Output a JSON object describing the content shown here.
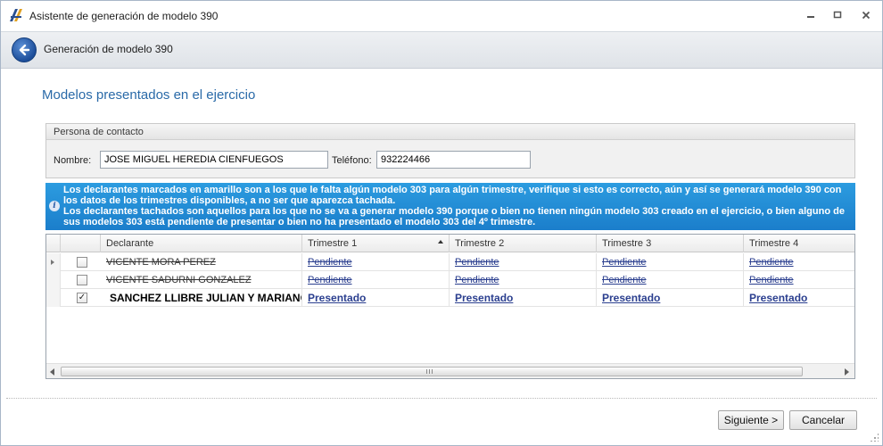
{
  "window": {
    "title": "Asistente de generación de modelo 390"
  },
  "header": {
    "title": "Generación de modelo 390"
  },
  "page": {
    "title": "Modelos presentados en el ejercicio"
  },
  "contact": {
    "group_title": "Persona de contacto",
    "name_label": "Nombre:",
    "name_value": "JOSE MIGUEL HEREDIA CIENFUEGOS",
    "phone_label": "Teléfono:",
    "phone_value": "932224466"
  },
  "banner": {
    "line1": "Los declarantes marcados en amarillo son a los que le falta algún modelo 303 para algún trimestre, verifique si esto es correcto, aún y así se generará modelo 390 con los datos de los trimestres disponibles, a no ser que aparezca tachada.",
    "line2": "Los declarantes tachados son aquellos para los que no se va a generar modelo 390 porque o bien no tienen ningún modelo 303 creado en el ejercicio, o bien alguno de sus modelos 303 está pendiente de presentar o bien no ha presentado el modelo 303 del 4º trimestre."
  },
  "grid": {
    "columns": [
      "Declarante",
      "Trimestre 1",
      "Trimestre 2",
      "Trimestre 3",
      "Trimestre 4"
    ],
    "rows": [
      {
        "checked": false,
        "struck": true,
        "declarante": "VICENTE MORA PEREZ",
        "t1": "Pendiente",
        "t2": "Pendiente",
        "t3": "Pendiente",
        "t4": "Pendiente"
      },
      {
        "checked": false,
        "struck": true,
        "declarante": "VICENTE SADURNI GONZALEZ",
        "t1": "Pendiente",
        "t2": "Pendiente",
        "t3": "Pendiente",
        "t4": "Pendiente"
      },
      {
        "checked": true,
        "struck": false,
        "declarante": "SANCHEZ LLIBRE JULIAN Y MARIANO...",
        "t1": "Presentado",
        "t2": "Presentado",
        "t3": "Presentado",
        "t4": "Presentado"
      }
    ]
  },
  "buttons": {
    "next": "Siguiente >",
    "cancel": "Cancelar"
  },
  "colors": {
    "accent": "#2a6aa8",
    "banner": "#1f88d4",
    "link": "#2b3f8f"
  }
}
